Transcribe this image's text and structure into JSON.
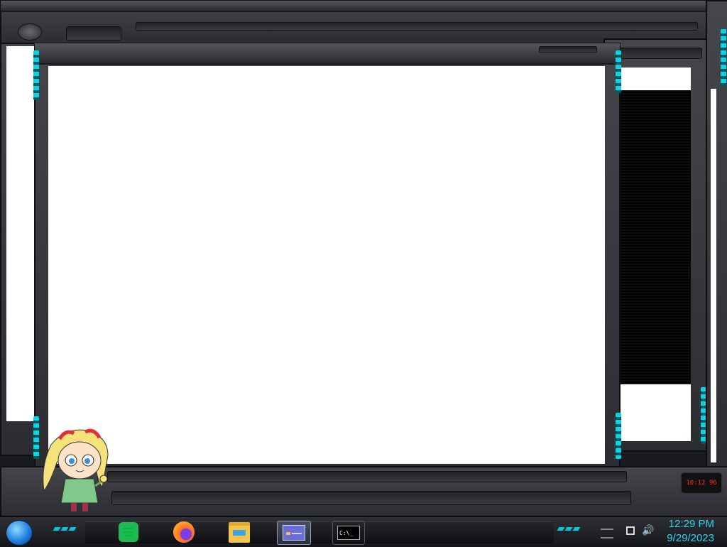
{
  "taskbar": {
    "apps": [
      {
        "name": "notes-app",
        "icon": "notes-icon",
        "color": "#1db954"
      },
      {
        "name": "firefox",
        "icon": "firefox-icon",
        "color": "#ff7139"
      },
      {
        "name": "file-explorer",
        "icon": "folder-icon",
        "color": "#f3c64b"
      },
      {
        "name": "control-panel",
        "icon": "window-icon",
        "color": "#6a6fd8"
      },
      {
        "name": "command-prompt",
        "icon": "terminal-icon",
        "color": "#000000"
      }
    ],
    "terminal_glyph": "C:\\_",
    "clock": {
      "time": "12:29 PM",
      "date": "9/29/2023"
    }
  },
  "widget": {
    "readout": "10:12 96"
  },
  "theme": {
    "accent": "#00d8e8",
    "frame": "#3a3b40",
    "clock": "#2fd6f0"
  }
}
